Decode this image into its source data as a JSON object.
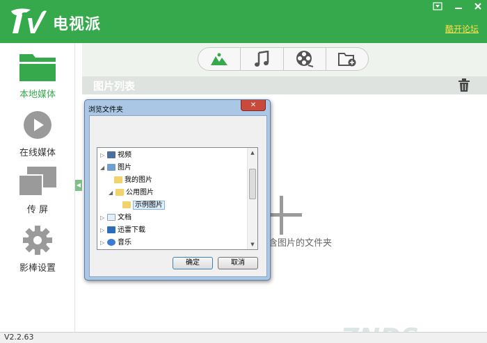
{
  "app": {
    "title": "电视派",
    "forum_link": "酷开论坛",
    "version": "V2.2.63",
    "brand_color": "#37a94d"
  },
  "window_controls": [
    "menu-icon",
    "minimize-icon",
    "close-icon"
  ],
  "sidebar": {
    "items": [
      {
        "label": "本地媒体",
        "icon": "folder-icon",
        "active": true
      },
      {
        "label": "在线媒体",
        "icon": "play-circle-icon",
        "active": false
      },
      {
        "label": "传  屏",
        "icon": "screen-mirror-icon",
        "active": false
      },
      {
        "label": "影棒设置",
        "icon": "gear-icon",
        "active": false
      }
    ]
  },
  "media_tabs": [
    {
      "icon": "picture-icon",
      "active": true
    },
    {
      "icon": "music-icon",
      "active": false
    },
    {
      "icon": "film-reel-icon",
      "active": false
    },
    {
      "icon": "add-folder-icon",
      "active": false
    }
  ],
  "main": {
    "list_title": "图片列表",
    "empty_hint": "含图片的文件夹",
    "watermark": "ZNDS.com"
  },
  "dialog": {
    "title": "浏览文件夹",
    "tree": [
      {
        "label": "视频",
        "icon": "video-folder-icon",
        "expanded": false,
        "selected": false
      },
      {
        "label": "图片",
        "icon": "pictures-folder-icon",
        "expanded": true,
        "selected": false
      },
      {
        "label": "我的图片",
        "icon": "folder-icon",
        "expanded": false,
        "selected": false
      },
      {
        "label": "公用图片",
        "icon": "folder-icon",
        "expanded": true,
        "selected": false
      },
      {
        "label": "示例图片",
        "icon": "folder-icon",
        "expanded": false,
        "selected": true
      },
      {
        "label": "文档",
        "icon": "documents-folder-icon",
        "expanded": false,
        "selected": false
      },
      {
        "label": "迅雷下载",
        "icon": "download-folder-icon",
        "expanded": false,
        "selected": false
      },
      {
        "label": "音乐",
        "icon": "music-folder-icon",
        "expanded": false,
        "selected": false
      }
    ],
    "ok_label": "确定",
    "cancel_label": "取消"
  }
}
